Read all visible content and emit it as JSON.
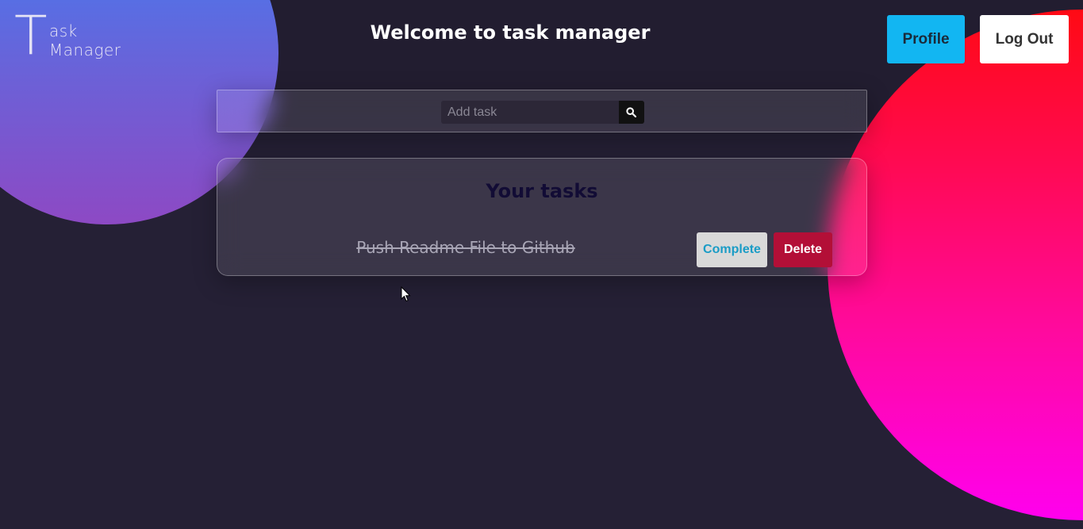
{
  "brand": {
    "logo_big": "T",
    "logo_line1": "ask",
    "logo_line2": "Manager"
  },
  "header": {
    "welcome": "Welcome to task manager",
    "profile_label": "Profile",
    "logout_label": "Log Out"
  },
  "add_task": {
    "placeholder": "Add task",
    "value": "",
    "submit_icon": "search-icon"
  },
  "tasks": {
    "title": "Your tasks",
    "items": [
      {
        "text": "Push Readme File to Github",
        "completed": true,
        "complete_label": "Complete",
        "delete_label": "Delete"
      }
    ]
  },
  "colors": {
    "background": "#252035",
    "profile_button": "#12b6f2",
    "logout_button": "#ffffff",
    "complete_button": "#d9d9d9",
    "complete_text": "#1a9cc6",
    "delete_button": "#b30f37",
    "blob_blue": "#3a82f6",
    "blob_purple": "#8d49c4",
    "blob_red": "#ff0a14",
    "blob_magenta": "#ff00ee"
  }
}
